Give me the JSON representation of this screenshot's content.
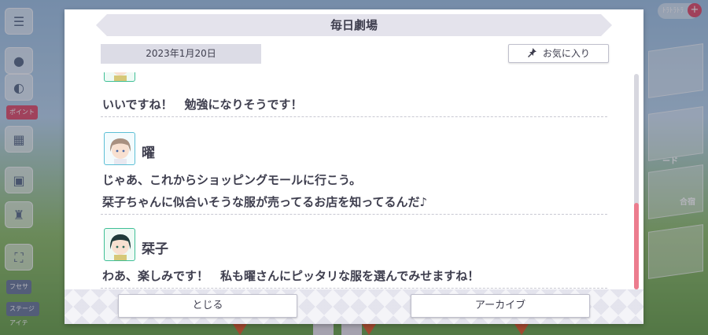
{
  "theater": {
    "title": "毎日劇場",
    "date": "2023年1月20日",
    "favorite_label": "お気に入り",
    "favorite_icon": "pin-icon"
  },
  "dialogue": {
    "partial_line": "いいですね！　勉強になりそうです！",
    "entries": [
      {
        "speaker": "曜",
        "avatar": "avatar-you",
        "lines": [
          "じゃあ、これからショッピングモールに行こう。",
          "栞子ちゃんに似合いそうな服が売ってるお店を知ってるんだ♪"
        ]
      },
      {
        "speaker": "栞子",
        "avatar": "avatar-shioriko",
        "lines": [
          "わあ、楽しみです！　私も曜さんにピッタリな服を選んでみせますね！"
        ]
      }
    ]
  },
  "buttons": {
    "close_label": "とじる",
    "archive_label": "アーカイブ"
  },
  "scroll": {
    "position_fraction": 1.0
  },
  "background": {
    "tags": [
      "ポイント",
      "フセサ",
      "ステージアイテ"
    ],
    "right_labels": [
      "ード",
      "合宿"
    ],
    "counter": "ﾄﾗﾄﾗﾄﾗ"
  },
  "colors": {
    "accent_scroll": "#ec7c8e",
    "avatar_blue": "#5dbfd6",
    "avatar_green": "#3fbf96",
    "text": "#3e3e4e"
  }
}
